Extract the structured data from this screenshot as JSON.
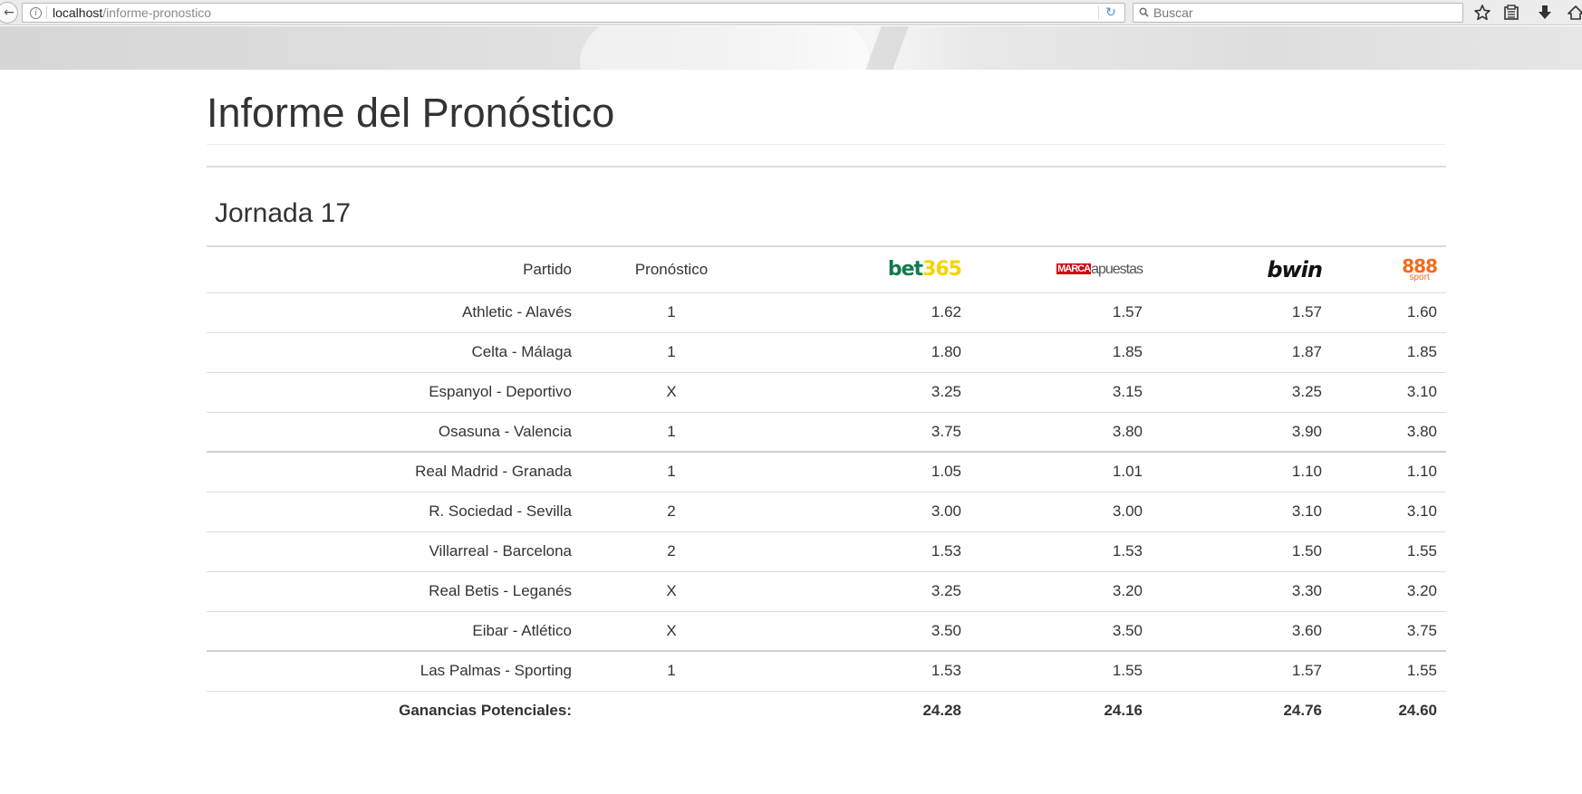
{
  "browser": {
    "url_host": "localhost",
    "url_path": "/informe-pronostico",
    "search_placeholder": "Buscar",
    "toolbar_icons": [
      "back-arrow-icon",
      "info-icon",
      "reload-icon",
      "search-icon",
      "bookmark-star-icon",
      "reader-icon",
      "download-icon",
      "home-icon"
    ]
  },
  "page": {
    "title": "Informe del Pronóstico",
    "subtitle": "Jornada 17"
  },
  "table": {
    "headers": {
      "match": "Partido",
      "prediction": "Pronóstico"
    },
    "bookmakers": [
      {
        "logo_parts": [
          "bet",
          "365"
        ],
        "colors": [
          "#127a4c",
          "#f3d400"
        ]
      },
      {
        "logo_parts": [
          "MARCA",
          "apuestas"
        ],
        "colors": [
          "#d4000f",
          "#555555"
        ]
      },
      {
        "logo_parts": [
          "bwin"
        ],
        "colors": [
          "#111111"
        ]
      },
      {
        "logo_parts": [
          "888",
          "sport"
        ],
        "colors": [
          "#f26b1d"
        ]
      }
    ],
    "rows": [
      {
        "match": "Athletic - Alavés",
        "prediction": "1",
        "odds": [
          "1.62",
          "1.57",
          "1.57",
          "1.60"
        ]
      },
      {
        "match": "Celta - Málaga",
        "prediction": "1",
        "odds": [
          "1.80",
          "1.85",
          "1.87",
          "1.85"
        ]
      },
      {
        "match": "Espanyol - Deportivo",
        "prediction": "X",
        "odds": [
          "3.25",
          "3.15",
          "3.25",
          "3.10"
        ]
      },
      {
        "match": "Osasuna - Valencia",
        "prediction": "1",
        "odds": [
          "3.75",
          "3.80",
          "3.90",
          "3.80"
        ]
      },
      {
        "match": "Real Madrid - Granada",
        "prediction": "1",
        "odds": [
          "1.05",
          "1.01",
          "1.10",
          "1.10"
        ]
      },
      {
        "match": "R. Sociedad - Sevilla",
        "prediction": "2",
        "odds": [
          "3.00",
          "3.00",
          "3.10",
          "3.10"
        ]
      },
      {
        "match": "Villarreal - Barcelona",
        "prediction": "2",
        "odds": [
          "1.53",
          "1.53",
          "1.50",
          "1.55"
        ]
      },
      {
        "match": "Real Betis - Leganés",
        "prediction": "X",
        "odds": [
          "3.25",
          "3.20",
          "3.30",
          "3.20"
        ]
      },
      {
        "match": "Eibar - Atlético",
        "prediction": "X",
        "odds": [
          "3.50",
          "3.50",
          "3.60",
          "3.75"
        ]
      },
      {
        "match": "Las Palmas - Sporting",
        "prediction": "1",
        "odds": [
          "1.53",
          "1.55",
          "1.57",
          "1.55"
        ]
      }
    ],
    "footer": {
      "label": "Ganancias Potenciales:",
      "totals": [
        "24.28",
        "24.16",
        "24.76",
        "24.60"
      ]
    }
  }
}
